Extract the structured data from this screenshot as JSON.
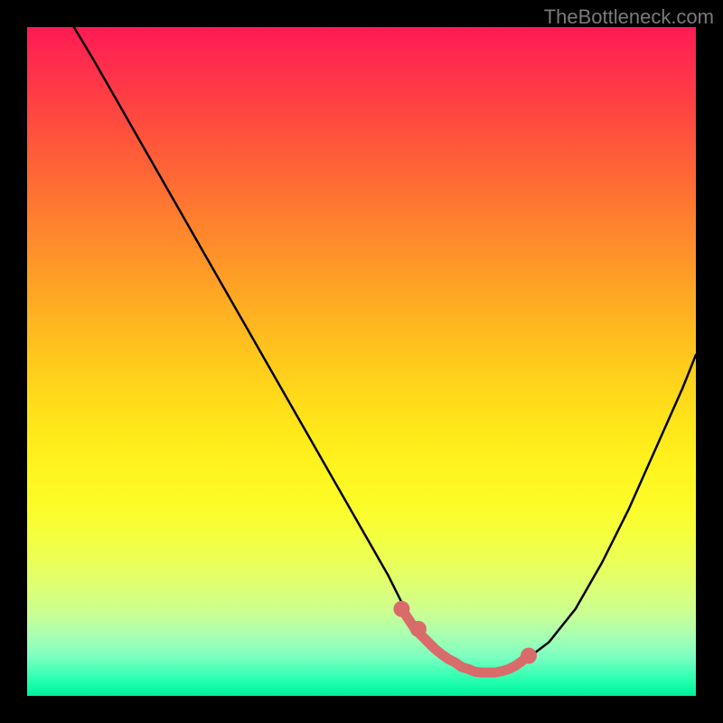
{
  "watermark": "TheBottleneck.com",
  "chart_data": {
    "type": "line",
    "title": "",
    "xlabel": "",
    "ylabel": "",
    "xlim": [
      0,
      100
    ],
    "ylim": [
      0,
      100
    ],
    "series": [
      {
        "name": "bottleneck-curve",
        "color": "#000000",
        "x": [
          7,
          10,
          14,
          18,
          22,
          26,
          30,
          34,
          38,
          42,
          46,
          50,
          54,
          56,
          58,
          60,
          62,
          64,
          66,
          68,
          70,
          72,
          74,
          78,
          82,
          86,
          90,
          94,
          98,
          100
        ],
        "y": [
          100,
          95,
          88,
          81,
          74,
          67,
          60,
          53,
          46,
          39,
          32,
          25,
          18,
          14,
          11,
          8.5,
          6.5,
          5,
          4,
          3.5,
          3.5,
          4,
          5,
          8,
          13,
          20,
          28,
          37,
          46,
          51
        ]
      },
      {
        "name": "highlight-segment",
        "color": "#d96b6b",
        "x": [
          56,
          57,
          58,
          59,
          60,
          61,
          62,
          63,
          64,
          65,
          66,
          67,
          68,
          69,
          70,
          71,
          72,
          73,
          74,
          75
        ],
        "y": [
          13,
          11.5,
          10,
          9,
          8,
          7,
          6.2,
          5.5,
          5,
          4.3,
          4,
          3.6,
          3.5,
          3.5,
          3.5,
          3.7,
          4,
          4.5,
          5.2,
          6
        ]
      }
    ],
    "highlight_dots": [
      {
        "x": 56,
        "y": 13
      },
      {
        "x": 58.5,
        "y": 10
      },
      {
        "x": 75,
        "y": 6
      }
    ],
    "background_gradient": {
      "top": "#ff1a53",
      "mid": "#ffe71a",
      "bottom": "#00f09a"
    }
  }
}
